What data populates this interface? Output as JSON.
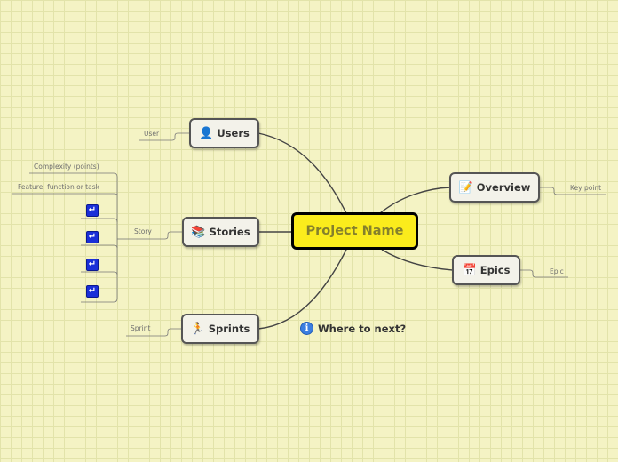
{
  "central": {
    "label": "Project Name"
  },
  "nodes": {
    "users": {
      "label": "Users",
      "icon": "user-icon",
      "note": "User"
    },
    "stories": {
      "label": "Stories",
      "icon": "books-icon",
      "note": "Story"
    },
    "sprints": {
      "label": "Sprints",
      "icon": "runner-icon",
      "note": "Sprint"
    },
    "overview": {
      "label": "Overview",
      "icon": "notepad-icon",
      "note": "Key point"
    },
    "epics": {
      "label": "Epics",
      "icon": "calendar-icon",
      "note": "Epic"
    }
  },
  "story_details": {
    "complexity": "Complexity (points)",
    "feature": "Feature, function or task",
    "tasks": [
      "task-1",
      "task-2",
      "task-3",
      "task-4"
    ]
  },
  "floating": {
    "label": "Where to next?",
    "icon": "info-icon"
  },
  "colors": {
    "background": "#f4f3c4",
    "grid": "#e2e3aa",
    "central_fill": "#fbec1c",
    "central_text": "#85802c",
    "node_fill": "#f3f2ea",
    "task_icon": "#1a2fd8"
  }
}
